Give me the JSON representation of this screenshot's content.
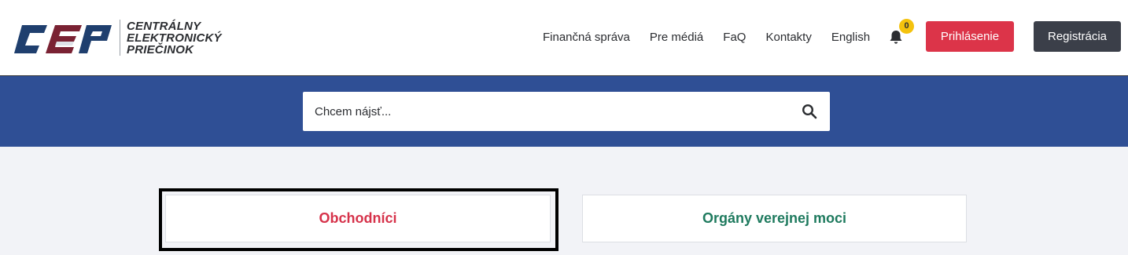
{
  "header": {
    "logo": {
      "mark_text": "CEP",
      "lines": [
        "CENTRÁLNY",
        "ELEKTRONICKÝ",
        "PRIEČINOK"
      ]
    },
    "nav": [
      {
        "label": "Finančná správa"
      },
      {
        "label": "Pre médiá"
      },
      {
        "label": "FaQ"
      },
      {
        "label": "Kontakty"
      },
      {
        "label": "English"
      }
    ],
    "notifications": {
      "count": "0"
    },
    "login_label": "Prihlásenie",
    "register_label": "Registrácia"
  },
  "search": {
    "placeholder": "Chcem nájsť..."
  },
  "cards": [
    {
      "label": "Obchodníci"
    },
    {
      "label": "Orgány verejnej moci"
    }
  ],
  "colors": {
    "header_bg": "#ffffff",
    "search_band": "#2f4f95",
    "login_button": "#dc3449",
    "register_button": "#3b3f49",
    "badge": "#f4c20d",
    "card_1_text": "#d6324a",
    "card_2_text": "#1e7a5e"
  }
}
